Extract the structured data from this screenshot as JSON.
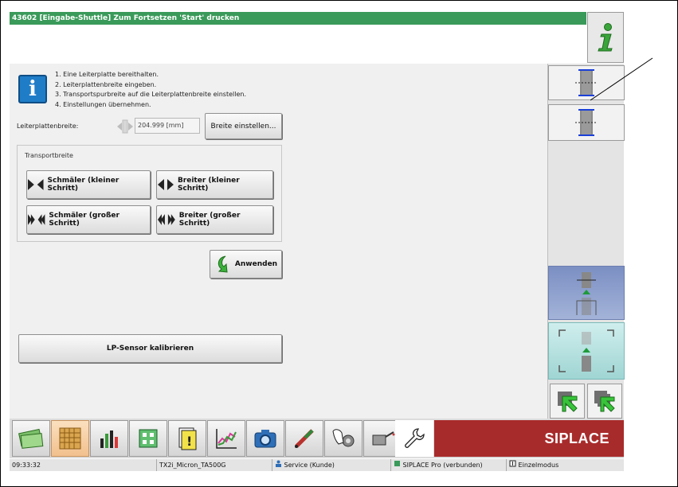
{
  "title": "43602 [Eingabe-Shuttle] Zum Fortsetzen 'Start' drucken",
  "info_button_icon": "info-icon",
  "instructions": [
    "1. Eine Leiterplatte bereithalten.",
    "2. Leiterplattenbreite eingeben.",
    "3. Transportspurbreite auf die Leiterplattenbreite einstellen.",
    "4. Einstellungen übernehmen."
  ],
  "width": {
    "label": "Leiterplattenbreite:",
    "value": "204.999 [mm]",
    "set_button": "Breite einstellen..."
  },
  "transport": {
    "title": "Transportbreite",
    "narrow_small": "Schmäler (kleiner Schritt)",
    "wider_small": "Breiter (kleiner Schritt)",
    "narrow_large": "Schmäler (großer Schritt)",
    "wider_large": "Breiter (großer Schritt)"
  },
  "apply_button": "Anwenden",
  "calibrate_button": "LP-Sensor kalibrieren",
  "brand": "SIPLACE",
  "status": {
    "time": "09:33:32",
    "machine": "TX2i_Micron_TA500G",
    "user": "Service (Kunde)",
    "connection": "SIPLACE Pro (verbunden)",
    "mode": "Einzelmodus"
  },
  "colors": {
    "title_bar": "#3a9a5a",
    "brand_bg": "#a82b2b",
    "active_tab": "#f2c08d"
  },
  "taskbar_icons": [
    "money-icon",
    "grid-icon",
    "bar-chart-icon",
    "board-icon",
    "warning-icon",
    "line-chart-icon",
    "camera-icon",
    "tool-icon",
    "gear-hand-icon",
    "oil-can-icon",
    "wrench-icon"
  ]
}
